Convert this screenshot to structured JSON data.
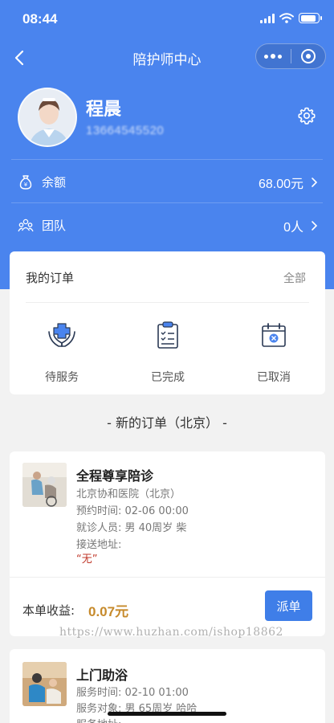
{
  "status_bar": {
    "time": "08:44",
    "battery_level": 0.9
  },
  "navbar": {
    "title": "陪护师中心"
  },
  "profile": {
    "name": "程晨",
    "phone": "13664545520"
  },
  "stats": [
    {
      "icon": "money-bag-icon",
      "label": "余额",
      "value": "68.00元"
    },
    {
      "icon": "team-icon",
      "label": "团队",
      "value": "0人"
    }
  ],
  "orders": {
    "title": "我的订单",
    "all_label": "全部",
    "statuses": [
      {
        "icon": "care-hands-icon",
        "label": "待服务"
      },
      {
        "icon": "clipboard-check-icon",
        "label": "已完成"
      },
      {
        "icon": "calendar-cancel-icon",
        "label": "已取消"
      }
    ]
  },
  "section_title": "- 新的订单（北京） -",
  "tasks": [
    {
      "title": "全程尊享陪诊",
      "lines": [
        "北京协和医院（北京）",
        "预约时间:  02-06 00:00",
        "就诊人员:  男 40周岁 柴",
        "接送地址:"
      ],
      "note": "“无”",
      "earn_label": "本单收益:",
      "earn_value": "0.07元",
      "button": "派单"
    },
    {
      "title": "上门助浴",
      "lines": [
        "服务时间:  02-10 01:00",
        "服务对象:  男 65周岁 哈哈",
        "服务地址:"
      ]
    }
  ],
  "watermark": "https://www.huzhan.com/ishop18862",
  "colors": {
    "brand": "#4a84ee",
    "button": "#3f7ee8",
    "earnings": "#c68a2b",
    "note": "#c0392b"
  }
}
